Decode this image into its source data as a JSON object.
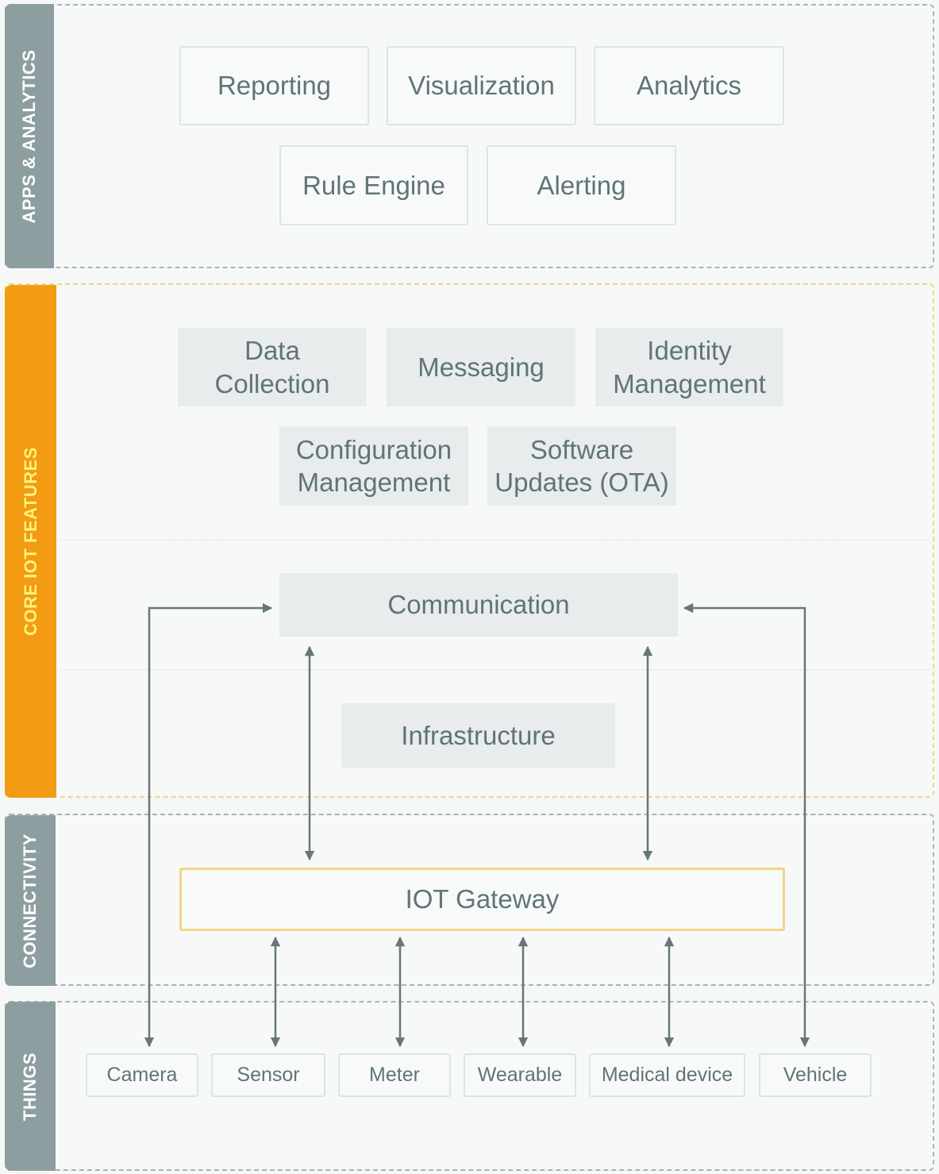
{
  "layers": {
    "apps": {
      "label": "APPS & ANALYTICS",
      "items": [
        "Reporting",
        "Visualization",
        "Analytics",
        "Rule Engine",
        "Alerting"
      ]
    },
    "core": {
      "label": "CORE IOT FEATURES",
      "items": [
        "Data\nCollection",
        "Messaging",
        "Identity\nManagement",
        "Configuration\nManagement",
        "Software\nUpdates (OTA)"
      ],
      "communication": "Communication",
      "infrastructure": "Infrastructure"
    },
    "connectivity": {
      "label": "CONNECTIVITY",
      "gateway": "IOT Gateway"
    },
    "things": {
      "label": "THINGS",
      "items": [
        "Camera",
        "Sensor",
        "Meter",
        "Wearable",
        "Medical device",
        "Vehicle"
      ]
    }
  },
  "connections": [
    {
      "from": "Camera",
      "to": "Communication",
      "direction": "bidirectional"
    },
    {
      "from": "Vehicle",
      "to": "Communication",
      "direction": "bidirectional"
    },
    {
      "from": "IOT Gateway",
      "to": "Communication",
      "direction": "bidirectional",
      "count": 2
    },
    {
      "from": "Sensor",
      "to": "IOT Gateway",
      "direction": "bidirectional"
    },
    {
      "from": "Meter",
      "to": "IOT Gateway",
      "direction": "bidirectional"
    },
    {
      "from": "Wearable",
      "to": "IOT Gateway",
      "direction": "bidirectional"
    },
    {
      "from": "Medical device",
      "to": "IOT Gateway",
      "direction": "bidirectional"
    }
  ],
  "colors": {
    "core_accent": "#f39b12",
    "core_label": "#fff27a",
    "layer_band": "#8d9ea1",
    "gateway_border": "#f2d488",
    "arrow": "#66777b"
  }
}
